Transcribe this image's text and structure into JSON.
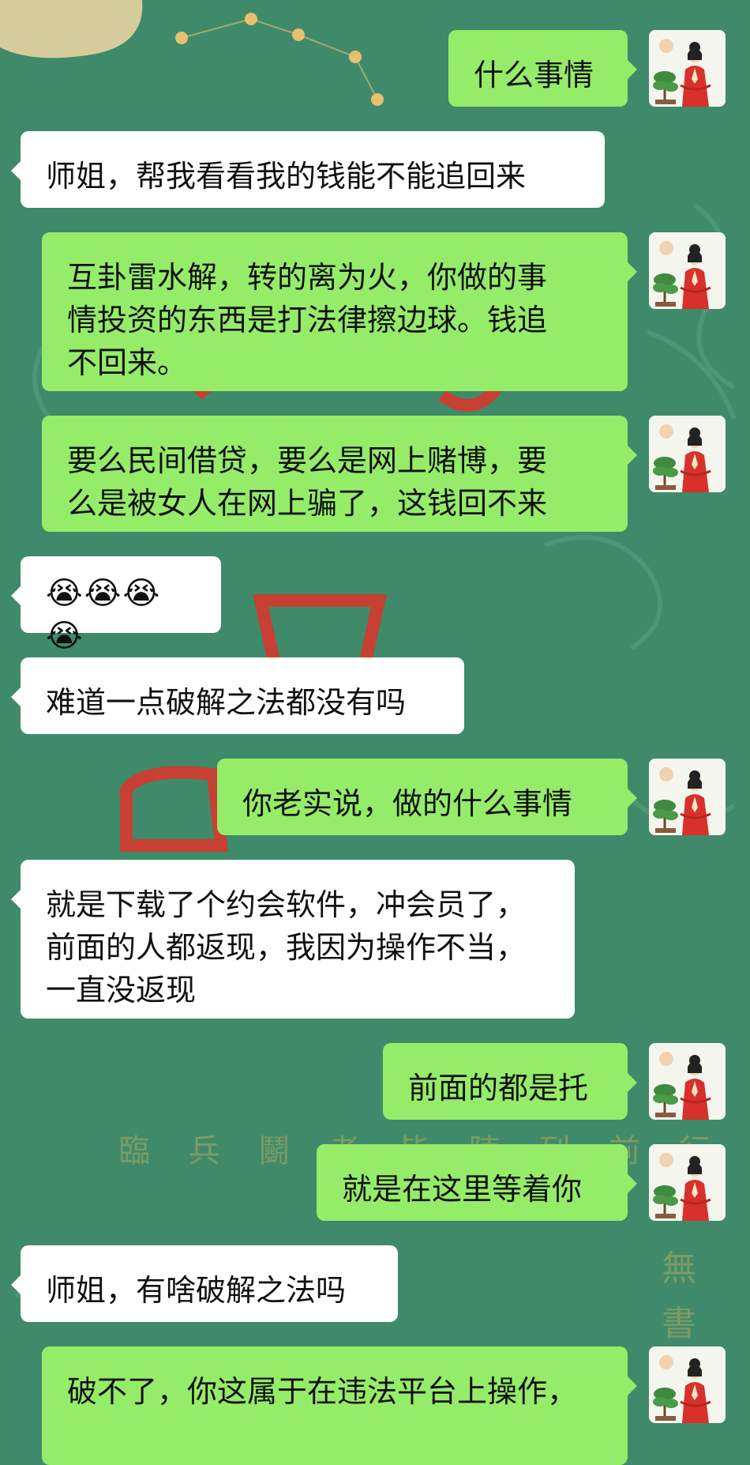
{
  "chat": {
    "background_color": "#3f8a6a",
    "background_text": "臨 兵 鬭 者 皆 陣 列 前 行",
    "messages": [
      {
        "side": "out",
        "text": "什么事情"
      },
      {
        "side": "in",
        "text": "师姐，帮我看看我的钱能不能追回来"
      },
      {
        "side": "out",
        "text": "互卦雷水解，转的离为火，你做的事\n情投资的东西是打法律擦边球。钱追\n不回来。"
      },
      {
        "side": "out",
        "text": "要么民间借贷，要么是网上赌博，要\n么是被女人在网上骗了，这钱回不来"
      },
      {
        "side": "in",
        "text": "😭😭😭😭"
      },
      {
        "side": "in",
        "text": "难道一点破解之法都没有吗"
      },
      {
        "side": "out",
        "text": "你老实说，做的什么事情"
      },
      {
        "side": "in",
        "text": "就是下载了个约会软件，冲会员了，\n前面的人都返现，我因为操作不当，\n一直没返现"
      },
      {
        "side": "out",
        "text": "前面的都是托"
      },
      {
        "side": "out",
        "text": "就是在这里等着你"
      },
      {
        "side": "in",
        "text": "师姐，有啥破解之法吗"
      },
      {
        "side": "out",
        "text": "破不了，你这属于在违法平台上操作，\n"
      }
    ],
    "avatar": {
      "icon": "avatar-woman-red-robe-icon"
    }
  }
}
